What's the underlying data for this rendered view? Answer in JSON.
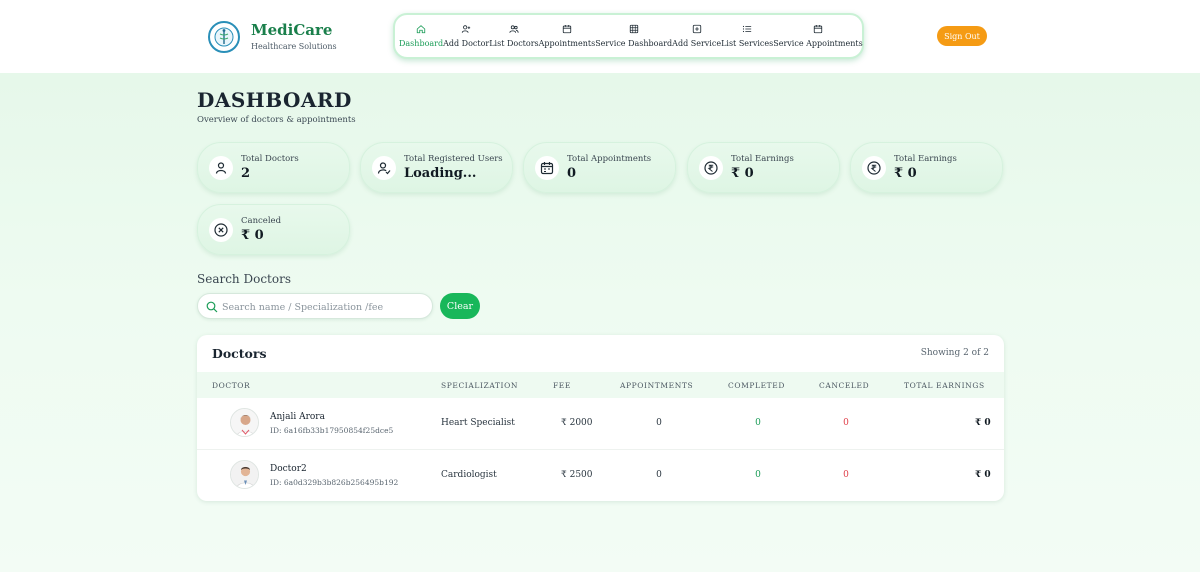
{
  "brand": {
    "title": "MediCare",
    "subtitle": "Healthcare Solutions"
  },
  "nav": [
    {
      "label": "Dashboard",
      "icon": "home-icon",
      "active": true
    },
    {
      "label": "Add Doctor",
      "icon": "user-plus-icon"
    },
    {
      "label": "List Doctors",
      "icon": "users-icon"
    },
    {
      "label": "Appointments",
      "icon": "calendar-icon"
    },
    {
      "label": "Service Dashboard",
      "icon": "grid-icon"
    },
    {
      "label": "Add Service",
      "icon": "plus-square-icon"
    },
    {
      "label": "List Services",
      "icon": "list-icon"
    },
    {
      "label": "Service Appointments",
      "icon": "calendar-icon"
    }
  ],
  "header": {
    "signout_label": "Sign Out"
  },
  "page": {
    "title": "DASHBOARD",
    "subtitle": "Overview of doctors & appointments"
  },
  "stats": [
    {
      "label": "Total Doctors",
      "value": "2",
      "icon": "user-icon"
    },
    {
      "label": "Total Registered Users",
      "value": "Loading...",
      "icon": "user-check-icon"
    },
    {
      "label": "Total Appointments",
      "value": "0",
      "icon": "calendar-icon"
    },
    {
      "label": "Total Earnings",
      "value": "₹ 0",
      "icon": "rupee-icon"
    },
    {
      "label": "Total Earnings",
      "value": "₹ 0",
      "icon": "rupee-icon"
    },
    {
      "label": "Canceled",
      "value": "₹ 0",
      "icon": "x-circle-icon"
    }
  ],
  "search": {
    "heading": "Search Doctors",
    "placeholder": "Search name / Specialization /fee",
    "value": "",
    "clear_label": "Clear"
  },
  "table": {
    "title": "Doctors",
    "count": "Showing 2 of 2",
    "columns": [
      "DOCTOR",
      "SPECIALIZATION",
      "FEE",
      "APPOINTMENTS",
      "COMPLETED",
      "CANCELED",
      "TOTAL EARNINGS"
    ],
    "rows": [
      {
        "name": "Anjali Arora",
        "id": "ID: 6a16fb33b17950854f25dce5",
        "specialization": "Heart Specialist",
        "fee": "₹ 2000",
        "appointments": "0",
        "completed": "0",
        "canceled": "0",
        "earnings": "₹ 0"
      },
      {
        "name": "Doctor2",
        "id": "ID: 6a0d329b3b826b256495b192",
        "specialization": "Cardiologist",
        "fee": "₹ 2500",
        "appointments": "0",
        "completed": "0",
        "canceled": "0",
        "earnings": "₹ 0"
      }
    ]
  },
  "colors": {
    "accent": "#1a9c57",
    "signout": "#f59b14",
    "clear": "#18b75a",
    "danger": "#e0414b"
  }
}
